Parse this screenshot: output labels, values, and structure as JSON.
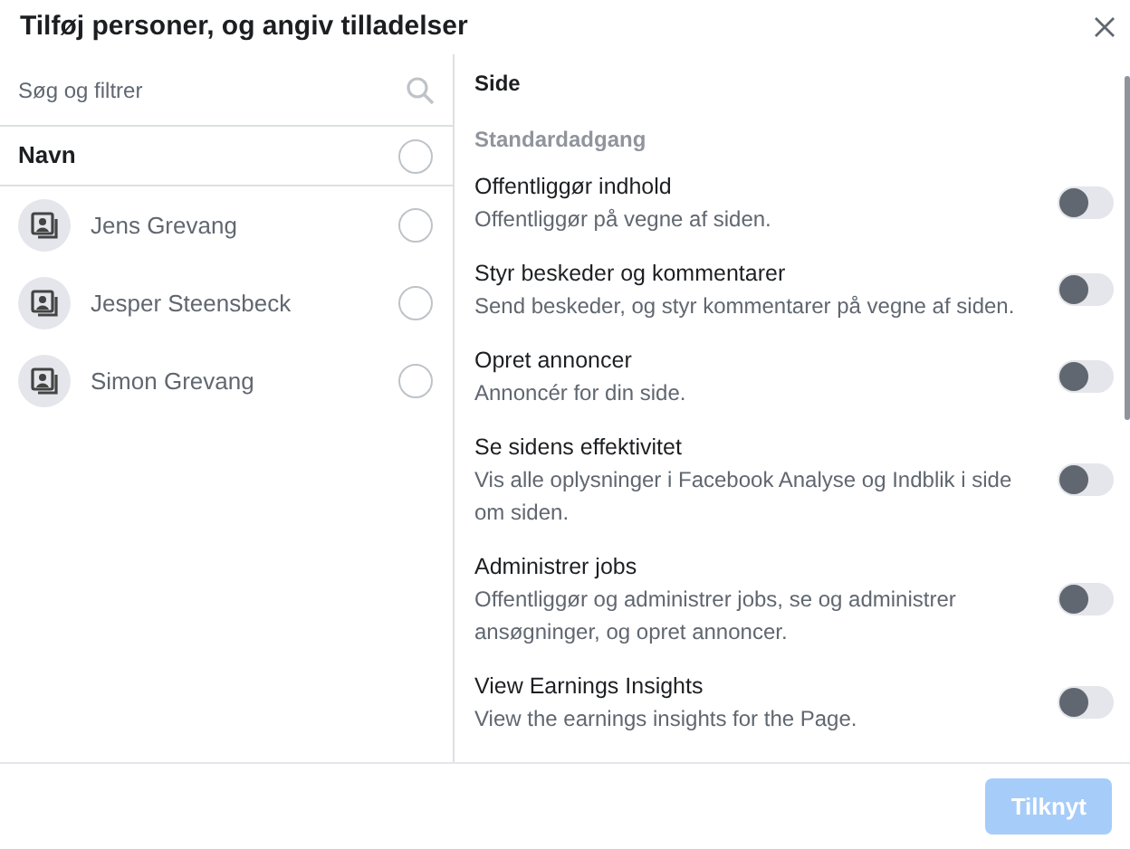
{
  "dialog": {
    "title": "Tilføj personer, og angiv tilladelser"
  },
  "search": {
    "placeholder": "Søg og filtrer"
  },
  "people_header": {
    "label": "Navn",
    "selected": false
  },
  "people": [
    {
      "name": "Jens Grevang",
      "selected": false
    },
    {
      "name": "Jesper Steensbeck",
      "selected": false
    },
    {
      "name": "Simon Grevang",
      "selected": false
    }
  ],
  "permissions": {
    "heading": "Side",
    "group": "Standardadgang",
    "items": [
      {
        "title": "Offentliggør indhold",
        "description": "Offentliggør på vegne af siden.",
        "on": false
      },
      {
        "title": "Styr beskeder og kommentarer",
        "description": "Send beskeder, og styr kommentarer på vegne af siden.",
        "on": false
      },
      {
        "title": "Opret annoncer",
        "description": "Annoncér for din side.",
        "on": false
      },
      {
        "title": "Se sidens effektivitet",
        "description": "Vis alle oplysninger i Facebook Analyse og Indblik i side om siden.",
        "on": false
      },
      {
        "title": "Administrer jobs",
        "description": "Offentliggør og administrer jobs, se og administrer ansøgninger, og opret annoncer.",
        "on": false
      },
      {
        "title": "View Earnings Insights",
        "description": "View the earnings insights for the Page.",
        "on": false
      }
    ]
  },
  "submit": {
    "label": "Tilknyt",
    "disabled": true
  }
}
